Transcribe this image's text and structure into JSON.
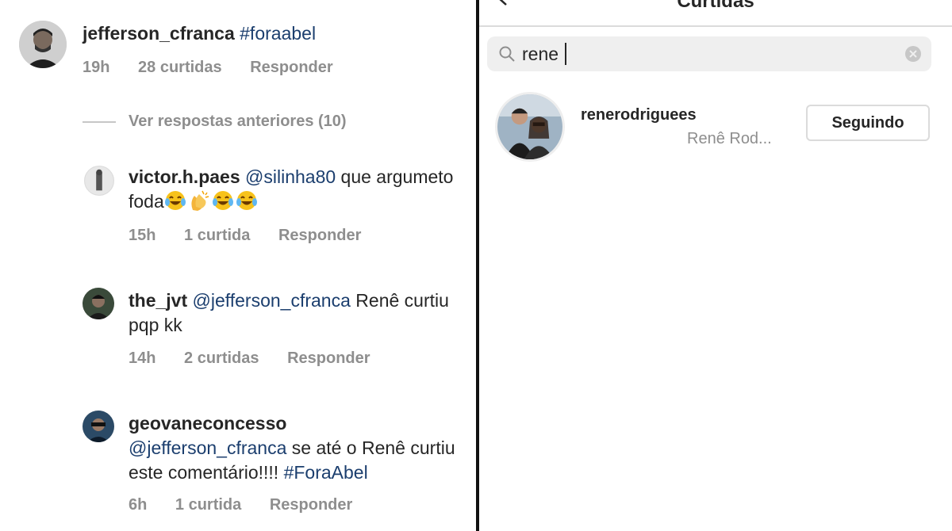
{
  "left": {
    "main_comment": {
      "username": "jefferson_cfranca",
      "hashtag": "#foraabel",
      "time": "19h",
      "likes": "28 curtidas",
      "reply": "Responder"
    },
    "view_replies": "Ver respostas anteriores (10)",
    "replies": [
      {
        "username": "victor.h.paes",
        "mention": "@silinha80",
        "text": " que argumeto foda",
        "time": "15h",
        "likes": "1 curtida",
        "reply": "Responder"
      },
      {
        "username": "the_jvt",
        "mention": "@jefferson_cfranca",
        "text": " Renê curtiu pqp kk",
        "time": "14h",
        "likes": "2 curtidas",
        "reply": "Responder"
      },
      {
        "username": "geovaneconcesso",
        "mention": "@jefferson_cfranca",
        "text": " se até o Renê curtiu este comentário!!!! ",
        "hashtag": "#ForaAbel",
        "time": "6h",
        "likes": "1 curtida",
        "reply": "Responder"
      }
    ],
    "emojis": [
      "face-with-tears-of-joy-icon",
      "clapping-hands-icon",
      "face-with-tears-of-joy-icon",
      "face-with-tears-of-joy-icon"
    ]
  },
  "right": {
    "title": "Curtidas",
    "search": {
      "value": "rene"
    },
    "result": {
      "username": "renerodriguees",
      "full_name": "Renê Rod...",
      "button": "Seguindo"
    }
  },
  "colors": {
    "mention": "#1b3e6e",
    "meta": "#8e8e8e",
    "text": "#262626"
  }
}
